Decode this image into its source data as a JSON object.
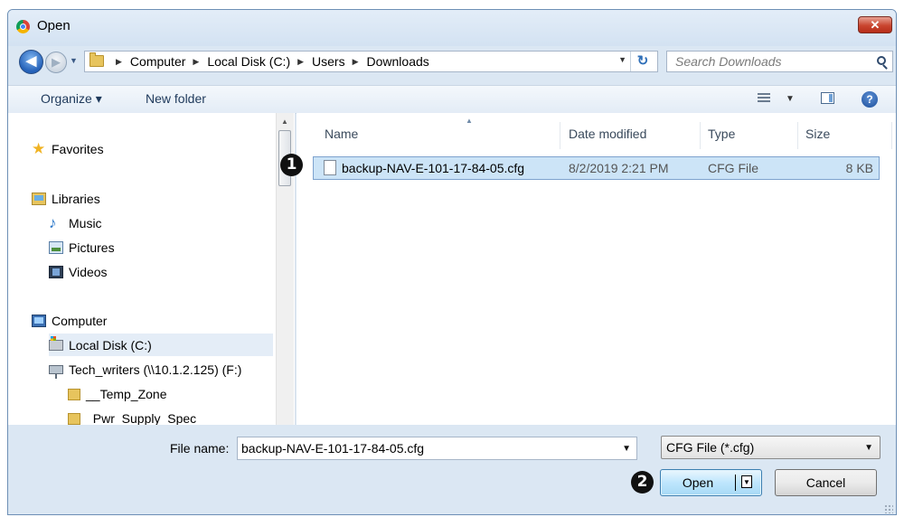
{
  "window": {
    "title": "Open",
    "close_label": "✕"
  },
  "address": {
    "breadcrumbs": [
      "Computer",
      "Local Disk (C:)",
      "Users",
      "Downloads"
    ]
  },
  "search": {
    "placeholder": "Search Downloads"
  },
  "toolbar": {
    "organize_label": "Organize ▾",
    "new_folder_label": "New folder"
  },
  "sidebar": {
    "favorites": "Favorites",
    "libraries": "Libraries",
    "library_items": [
      "Music",
      "Pictures",
      "Videos"
    ],
    "computer": "Computer",
    "drives": [
      "Local Disk (C:)",
      "Tech_writers (\\\\10.1.2.125) (F:)"
    ],
    "folders": [
      "__Temp_Zone",
      "_Pwr_Supply_Spec"
    ]
  },
  "file_list": {
    "columns": [
      "Name",
      "Date modified",
      "Type",
      "Size"
    ],
    "rows": [
      {
        "name": "backup-NAV-E-101-17-84-05.cfg",
        "date": "8/2/2019 2:21 PM",
        "type": "CFG File",
        "size": "8 KB"
      }
    ]
  },
  "footer": {
    "file_name_label": "File name:",
    "file_name_value": "backup-NAV-E-101-17-84-05.cfg",
    "file_type_value": "CFG File (*.cfg)",
    "open_label": "Open",
    "cancel_label": "Cancel"
  },
  "callouts": [
    "1",
    "2"
  ]
}
